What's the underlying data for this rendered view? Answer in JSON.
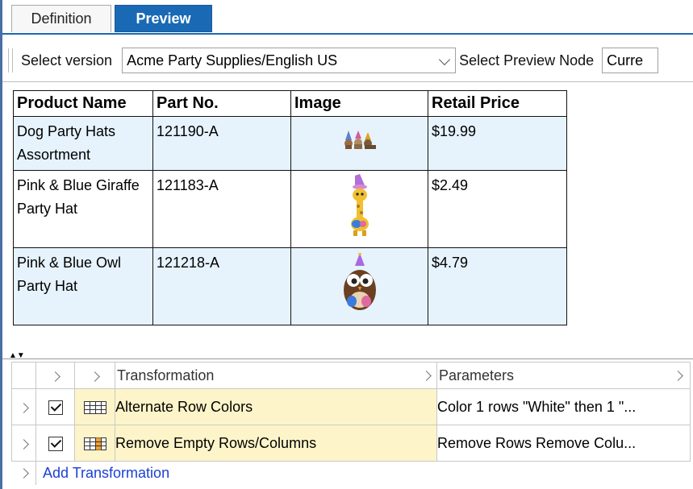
{
  "tabs": {
    "definition": "Definition",
    "preview": "Preview"
  },
  "toolbar": {
    "select_version_label": "Select version",
    "version_value": "Acme Party Supplies/English US",
    "select_node_label": "Select Preview Node",
    "node_value": "Curre"
  },
  "product_table": {
    "headers": [
      "Product Name",
      "Part No.",
      "Image",
      "Retail Price"
    ],
    "rows": [
      {
        "name": "Dog Party Hats Assortment",
        "part": "121190-A",
        "image_icon": "dog-party-hats-icon",
        "price": "$19.99"
      },
      {
        "name": "Pink & Blue Giraffe Party Hat",
        "part": "121183-A",
        "image_icon": "giraffe-party-hat-icon",
        "price": "$2.49"
      },
      {
        "name": "Pink & Blue Owl Party Hat",
        "part": "121218-A",
        "image_icon": "owl-party-hat-icon",
        "price": "$4.79"
      }
    ]
  },
  "transform_grid": {
    "header": {
      "transformation": "Transformation",
      "parameters": "Parameters"
    },
    "rows": [
      {
        "checked": true,
        "icon": "table-grid-icon",
        "name": "Alternate Row Colors",
        "params": "Color 1 rows \"White\" then 1 \"..."
      },
      {
        "checked": true,
        "icon": "table-grid-orange-icon",
        "name": "Remove Empty Rows/Columns",
        "params": "Remove Rows Remove Colu..."
      }
    ],
    "add_label": "Add Transformation"
  },
  "colors": {
    "accent": "#1a69b4",
    "row_alt": "#e6f3fd",
    "highlight": "#fdf5c9",
    "link": "#1a3fd6"
  }
}
